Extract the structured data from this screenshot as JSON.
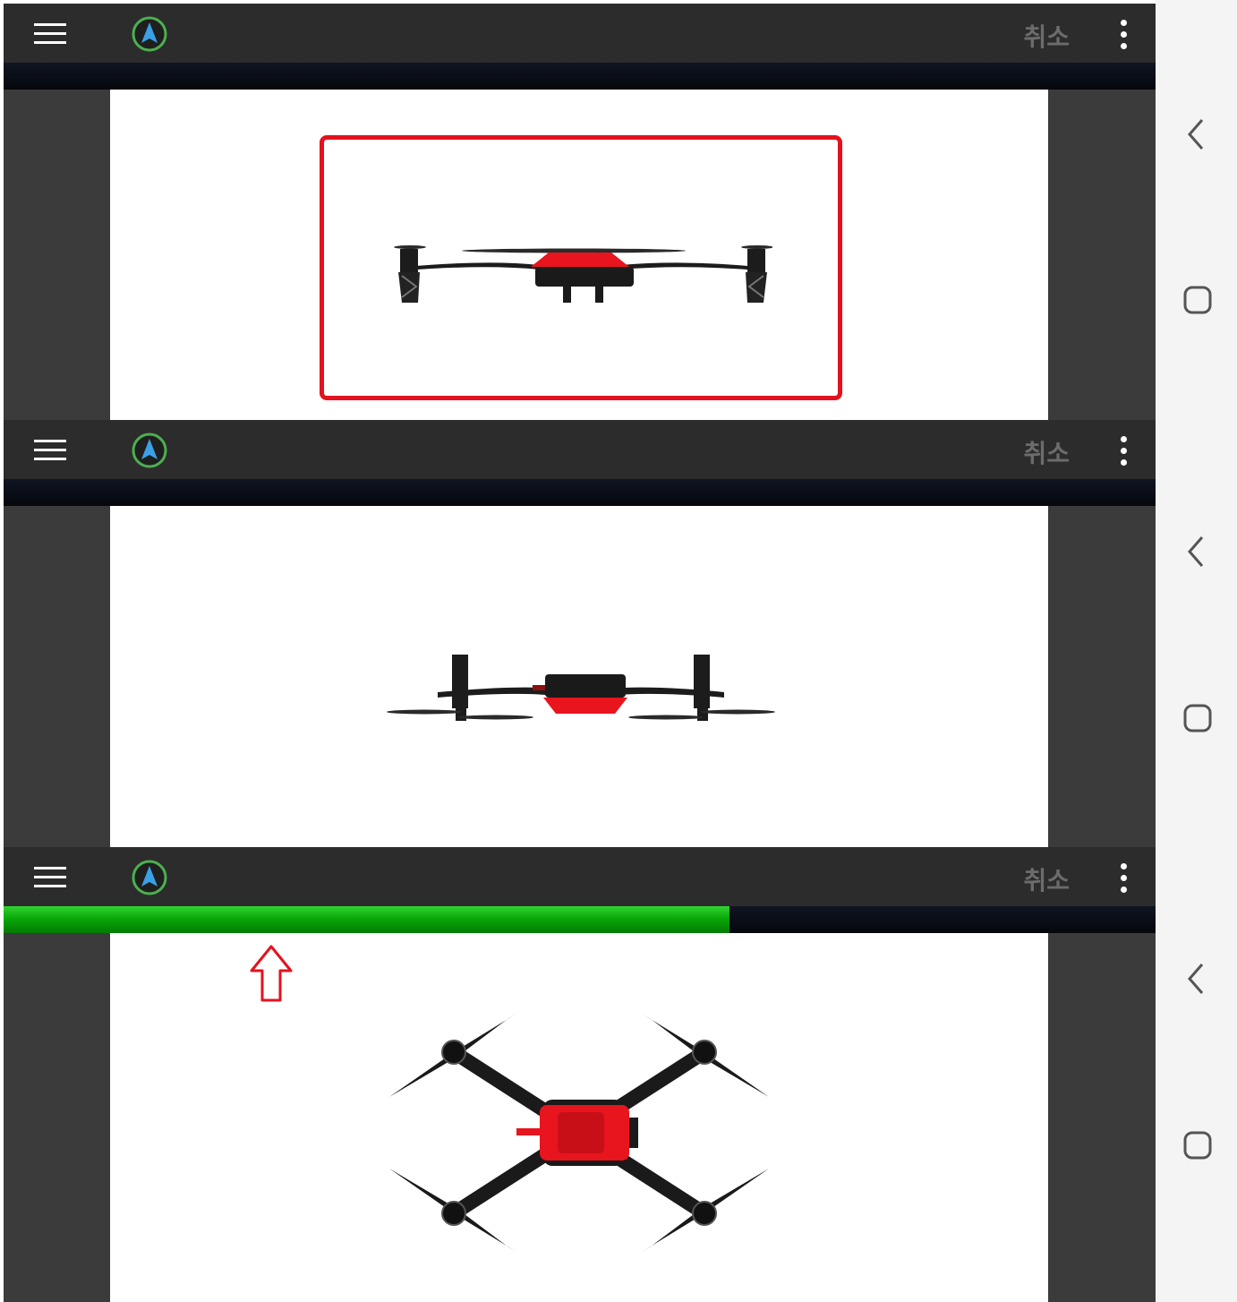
{
  "app_bar": {
    "cancel_label": "취소",
    "menu_icon": "hamburger-menu-icon",
    "logo_icon": "navigation-compass-icon",
    "more_icon": "vertical-dots-icon"
  },
  "panels": [
    {
      "view": "drone-front-view",
      "highlighted": true,
      "progress_percent": 0
    },
    {
      "view": "drone-underside-side-view",
      "highlighted": false,
      "progress_percent": 0
    },
    {
      "view": "drone-top-view",
      "highlighted": false,
      "progress_percent": 63
    }
  ],
  "annotations": {
    "arrow": "red-up-arrow-icon",
    "highlight_color": "#e3121d"
  },
  "colors": {
    "appbar": "#2c2c2c",
    "progress": "#07a407",
    "drone_body": "#e8141e",
    "accent": "#3aa0e8"
  },
  "system_nav": {
    "back_icon": "back-chevron-icon",
    "home_icon": "home-square-icon"
  }
}
